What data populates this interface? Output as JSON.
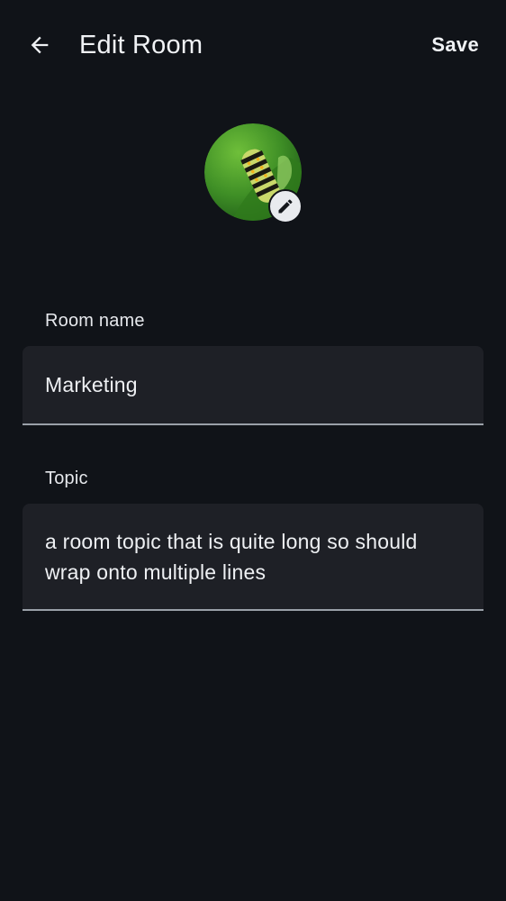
{
  "header": {
    "title": "Edit Room",
    "save_label": "Save",
    "back_icon": "arrow-back-icon"
  },
  "avatar": {
    "image": "caterpillar-photo",
    "edit_icon": "pencil-icon"
  },
  "form": {
    "room_name": {
      "label": "Room name",
      "value": "Marketing"
    },
    "topic": {
      "label": "Topic",
      "value": "a room topic that is quite long so should wrap onto multiple lines"
    }
  },
  "colors": {
    "background": "#101318",
    "field_background": "#1e2026",
    "field_underline": "#9aa0a8",
    "text": "#eef0f3",
    "badge": "#e9ebef"
  }
}
